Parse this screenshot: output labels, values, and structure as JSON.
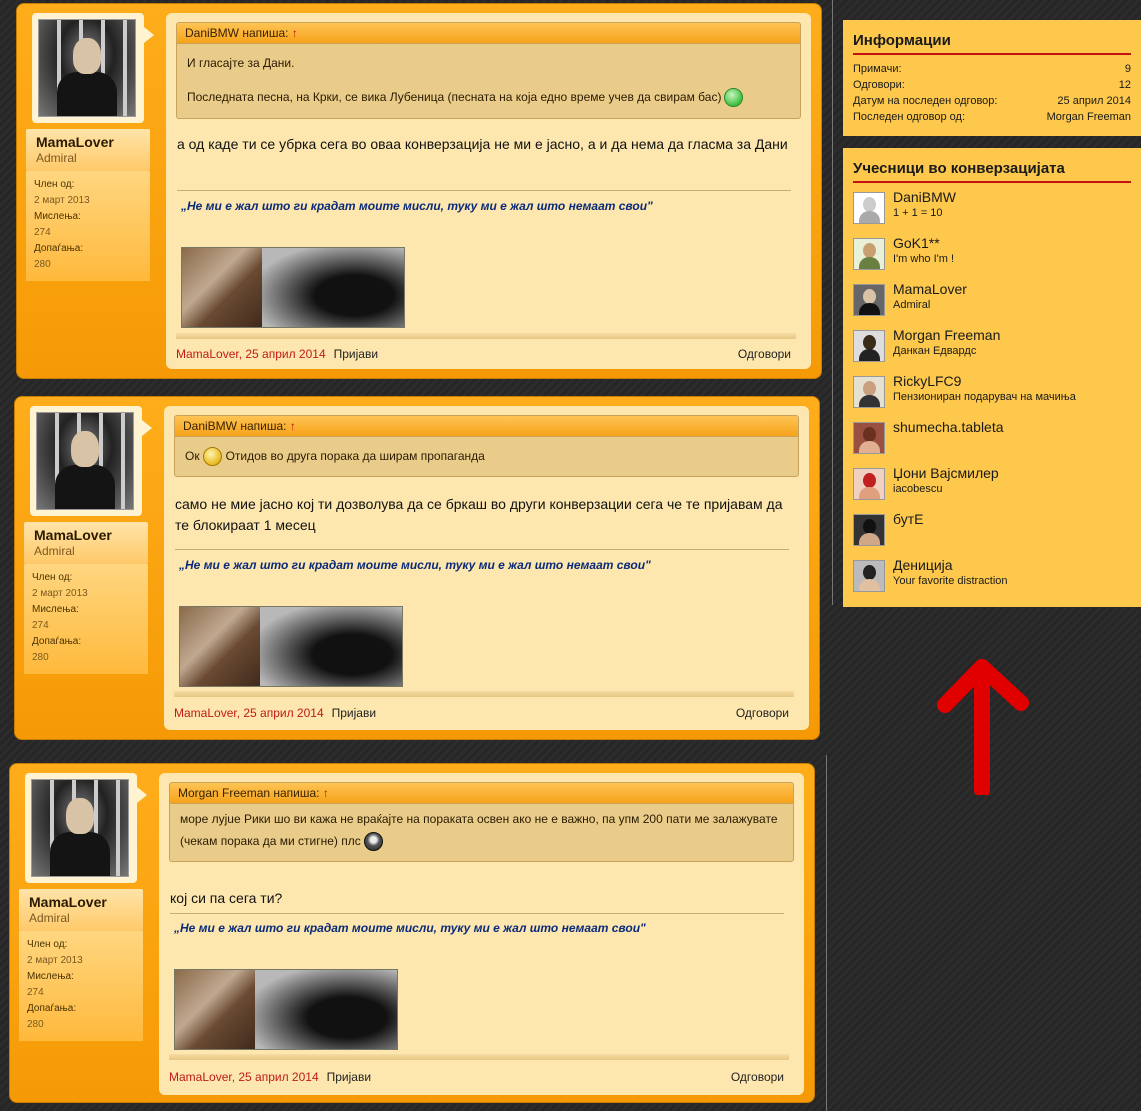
{
  "user": {
    "name": "MamaLover",
    "role": "Admiral",
    "member_since_label": "Член од:",
    "member_since": "2 март 2013",
    "opinions_label": "Мислења:",
    "opinions": "274",
    "likes_label": "Допаѓања:",
    "likes": "280"
  },
  "signature": "„Не ми е жал што ги крадат моите мисли, туку ми е жал што немаат свои\"",
  "footer": {
    "report": "Пријави",
    "reply": "Одговори"
  },
  "posts": [
    {
      "quote_author": "DaniBMW напиша:",
      "quote_arrow": "↑",
      "quote_line1": "И гласајте за Дани.",
      "quote_line2": "Последната песна, на Крки, се вика Лубеница (песната на која едно време учев да свирам бас)",
      "message": "а од каде ти се убрка сега во оваа конверзација не ми е јасно, а и да нема да гласма за Дани",
      "byline": "MamaLover, 25 април 2014"
    },
    {
      "quote_author": "DaniBMW напиша:",
      "quote_arrow": "↑",
      "quote_line1": "Ок",
      "quote_line1b": "Отидов во друга порака да ширам пропаганда",
      "message": "само не мие јасно кој ти дозволува да се бркаш во други конверзации сега че те пријавам да те блокираат 1 месец",
      "byline": "MamaLover, 25 април 2014"
    },
    {
      "quote_author": "Morgan Freeman напиша:",
      "quote_arrow": "↑",
      "quote_line1": "море лујuе Рики шо ви кажа не враќајте на пораката освен ако не е важно, па упм 200 пати ме залажувате (чекам порака да ми стигне) плс",
      "message": "кој си па сега ти?",
      "byline": "MamaLover, 25 април 2014"
    }
  ],
  "info": {
    "title": "Информации",
    "rows": [
      {
        "label": "Примачи:",
        "value": "9"
      },
      {
        "label": "Одговори:",
        "value": "12"
      },
      {
        "label": "Датум на последен одговор:",
        "value": "25 април 2014"
      },
      {
        "label": "Последен одговор од:",
        "value": "Morgan Freeman"
      }
    ]
  },
  "participants": {
    "title": "Учесници во конверзацијата",
    "items": [
      {
        "name": "DaniBMW",
        "sub": "1 + 1 = 10"
      },
      {
        "name": "GoK1**",
        "sub": "I'm who I'm !"
      },
      {
        "name": "MamaLover",
        "sub": "Admiral"
      },
      {
        "name": "Morgan Freeman",
        "sub": "Данкан Едвардс"
      },
      {
        "name": "RickyLFC9",
        "sub": "Пензиониран подарувач на мачиња"
      },
      {
        "name": "shumecha.tableta",
        "sub": ""
      },
      {
        "name": "Џони Вајсмилер",
        "sub": "iacobescu"
      },
      {
        "name": "бутЕ",
        "sub": ""
      },
      {
        "name": "Дениција",
        "sub": "Your favorite distraction"
      }
    ]
  },
  "colors": {
    "accent": "#f7a10d",
    "panel": "#fdc84b",
    "rule": "#c41010",
    "author": "#c01a1a",
    "signature": "#0a2a7a",
    "arrow": "#e00000"
  }
}
